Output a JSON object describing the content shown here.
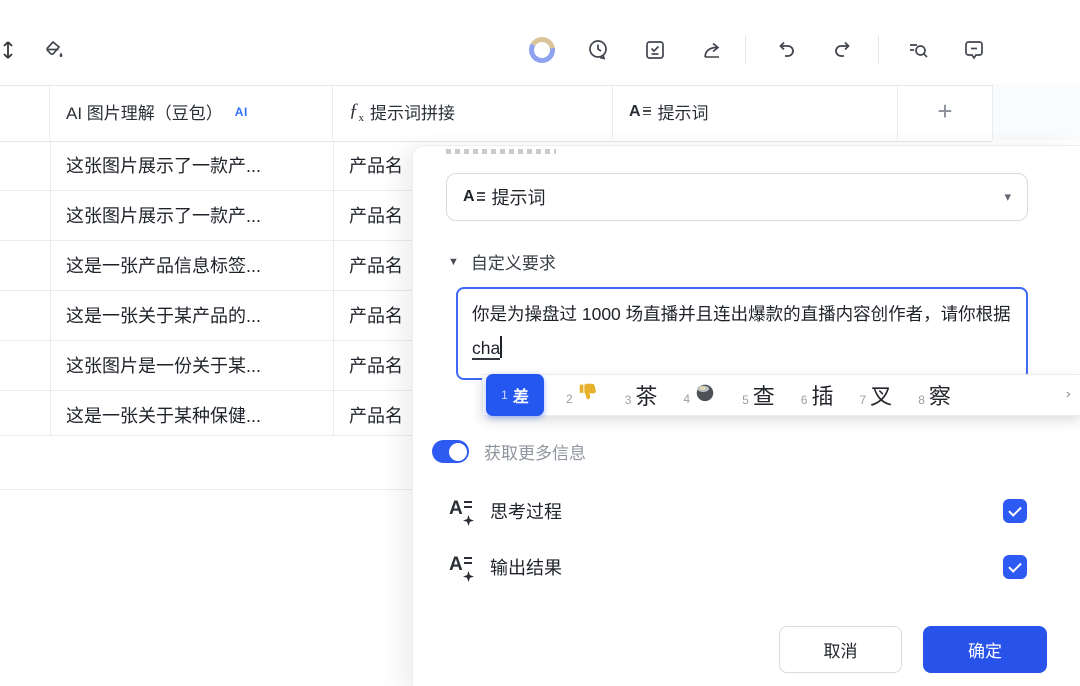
{
  "toolbar": {
    "icons": [
      "row-height",
      "paint-format",
      "ai-ring",
      "history",
      "task-check",
      "share",
      "undo",
      "redo",
      "search-records",
      "comment"
    ]
  },
  "table": {
    "columns": [
      {
        "label": "AI 图片理解（豆包）",
        "badge": "AI",
        "icon": "ai-media-field"
      },
      {
        "label": "提示词拼接",
        "icon": "formula-field"
      },
      {
        "label": "提示词",
        "icon": "text-field"
      },
      {
        "label": "+",
        "icon": "add-column"
      }
    ],
    "rows": [
      {
        "col1": "这张图片展示了一款产...",
        "col2": "产品名"
      },
      {
        "col1": "这张图片展示了一款产...",
        "col2": "产品名"
      },
      {
        "col1": "这是一张产品信息标签...",
        "col2": "产品名"
      },
      {
        "col1": "这是一张关于某产品的...",
        "col2": "产品名"
      },
      {
        "col1": "这张图片是一份关于某...",
        "col2": "产品名"
      },
      {
        "col1": "这是一张关于某种保健...",
        "col2": "产品名"
      }
    ]
  },
  "dialog": {
    "field_select": {
      "value": "提示词",
      "caret": "▾"
    },
    "section": {
      "collapse_icon": "▼",
      "title": "自定义要求"
    },
    "prompt": {
      "text": "你是为操盘过 1000 场直播并且连出爆款的直播内容创作者，请你根据",
      "composition": "cha"
    },
    "toggle": {
      "label": "获取更多信息",
      "on": true
    },
    "options": [
      {
        "label": "思考过程",
        "checked": true
      },
      {
        "label": "输出结果",
        "checked": true
      }
    ],
    "cancel_label": "取消",
    "confirm_label": "确定"
  },
  "ime": {
    "candidates": [
      {
        "index": "1",
        "text": "差",
        "selected": true
      },
      {
        "index": "2",
        "glyph": "thumbs-down-emoji"
      },
      {
        "index": "3",
        "text": "茶"
      },
      {
        "index": "4",
        "glyph": "teacup-emoji"
      },
      {
        "index": "5",
        "text": "查"
      },
      {
        "index": "6",
        "text": "插"
      },
      {
        "index": "7",
        "text": "叉"
      },
      {
        "index": "8",
        "text": "察"
      }
    ],
    "more_arrow": "›"
  },
  "colors": {
    "accent_blue": "#2d5af1",
    "confirm_blue": "#2853eb",
    "textarea_border": "#4069f5",
    "badge_blue": "#3370ff",
    "gridline": "#e9ebee",
    "muted_text": "#8f959e"
  }
}
